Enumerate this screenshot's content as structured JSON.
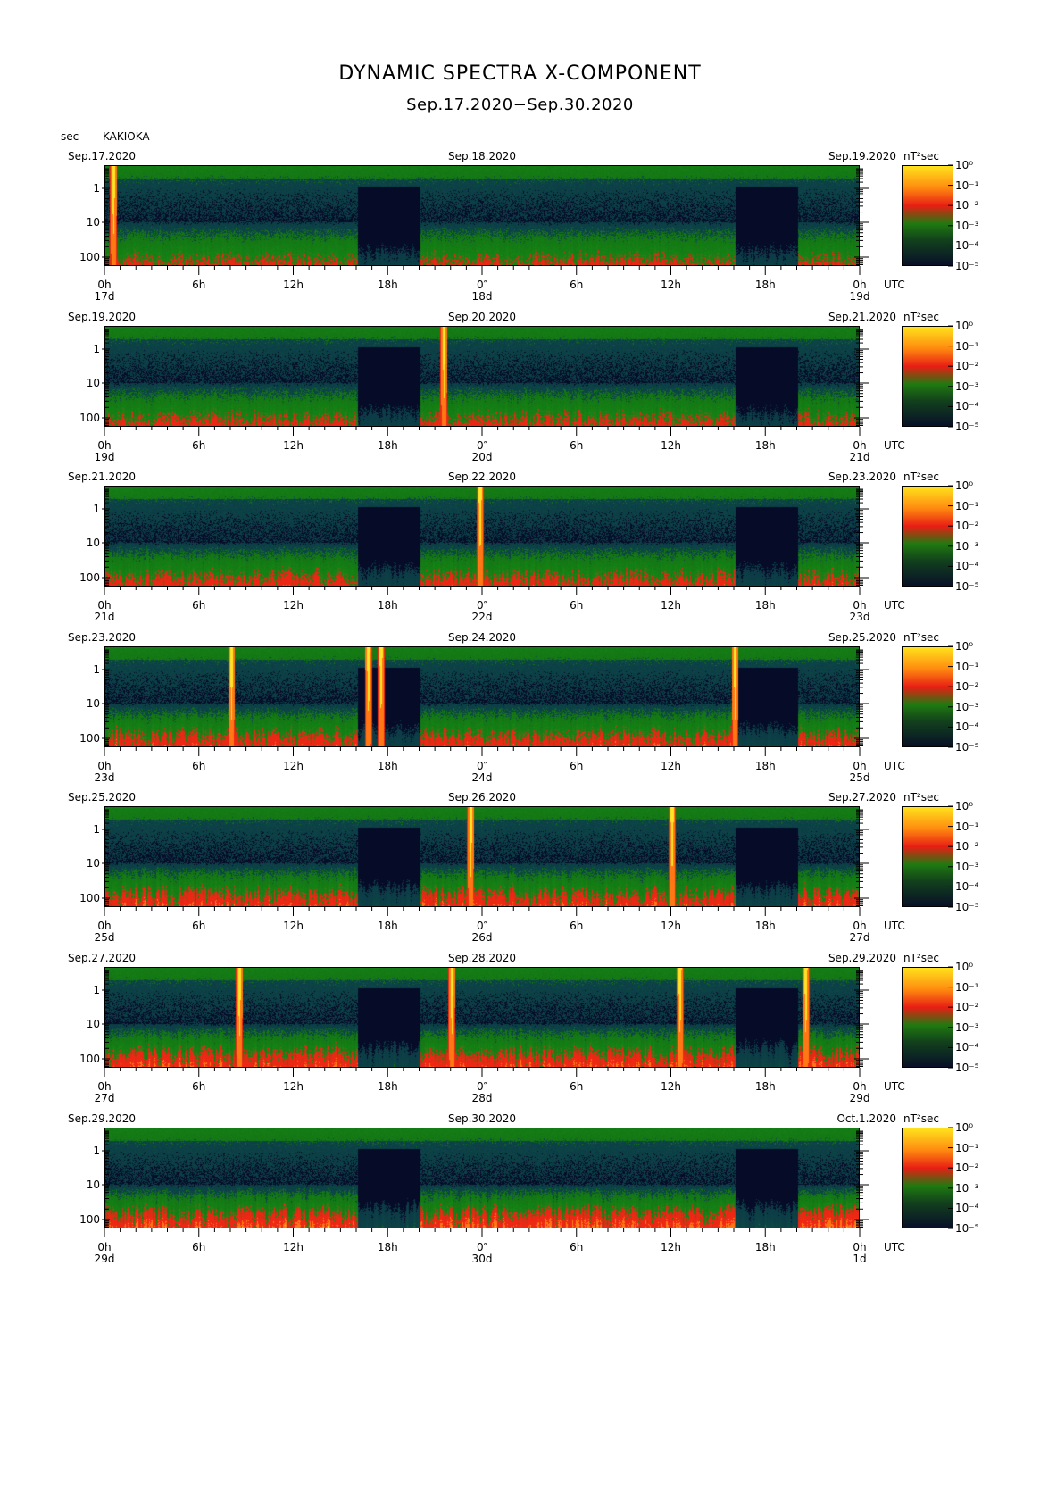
{
  "title": "DYNAMIC SPECTRA X-COMPONENT",
  "subtitle": "Sep.17.2020−Sep.30.2020",
  "y_unit": "sec",
  "station": "KAKIOKA",
  "utc_label": "UTC",
  "colorbar_unit": "nT²sec",
  "chart_data": {
    "type": "heatmap",
    "title": "DYNAMIC SPECTRA X-COMPONENT",
    "subtitle": "Sep.17.2020−Sep.30.2020",
    "ylabel": "sec",
    "y_scale": "log",
    "y_ticks": [
      "1",
      "10",
      "100"
    ],
    "x_ticks": [
      "0h",
      "6h",
      "12h",
      "18h",
      "0″",
      "6h",
      "12h",
      "18h",
      "0h"
    ],
    "colorbar": {
      "unit": "nT²sec",
      "scale": "log",
      "ticks": [
        "10⁰",
        "10⁻¹",
        "10⁻²",
        "10⁻³",
        "10⁻⁴",
        "10⁻⁵"
      ],
      "colors": [
        "#ffe21c",
        "#e81e14",
        "#1f7a10",
        "#081028"
      ]
    },
    "panels": [
      {
        "start_date": "Sep.17.2020",
        "mid_date": "Sep.18.2020",
        "end_date": "Sep.19.2020",
        "day_labels": [
          "17d",
          "18d",
          "19d"
        ],
        "spikes_h": [
          0.5
        ],
        "quiet_intervals_h": [
          [
            16,
            20
          ],
          [
            40,
            44
          ]
        ]
      },
      {
        "start_date": "Sep.19.2020",
        "mid_date": "Sep.20.2020",
        "end_date": "Sep.21.2020",
        "day_labels": [
          "19d",
          "20d",
          "21d"
        ],
        "spikes_h": [
          21.5
        ],
        "quiet_intervals_h": [
          [
            16,
            20
          ],
          [
            40,
            44
          ]
        ]
      },
      {
        "start_date": "Sep.21.2020",
        "mid_date": "Sep.22.2020",
        "end_date": "Sep.23.2020",
        "day_labels": [
          "21d",
          "22d",
          "23d"
        ],
        "spikes_h": [
          23.8
        ],
        "quiet_intervals_h": [
          [
            16,
            20
          ],
          [
            40,
            44
          ]
        ]
      },
      {
        "start_date": "Sep.23.2020",
        "mid_date": "Sep.24.2020",
        "end_date": "Sep.25.2020",
        "day_labels": [
          "23d",
          "24d",
          "25d"
        ],
        "spikes_h": [
          8,
          16.7,
          17.5,
          40
        ],
        "quiet_intervals_h": [
          [
            16,
            20
          ],
          [
            40,
            44
          ]
        ]
      },
      {
        "start_date": "Sep.25.2020",
        "mid_date": "Sep.26.2020",
        "end_date": "Sep.27.2020",
        "day_labels": [
          "25d",
          "26d",
          "27d"
        ],
        "spikes_h": [
          23.2,
          36
        ],
        "quiet_intervals_h": [
          [
            16,
            20
          ],
          [
            40,
            44
          ]
        ]
      },
      {
        "start_date": "Sep.27.2020",
        "mid_date": "Sep.28.2020",
        "end_date": "Sep.29.2020",
        "day_labels": [
          "27d",
          "28d",
          "29d"
        ],
        "spikes_h": [
          8.5,
          22,
          36.5,
          44.5
        ],
        "quiet_intervals_h": [
          [
            16,
            20
          ],
          [
            40,
            44
          ]
        ]
      },
      {
        "start_date": "Sep.29.2020",
        "mid_date": "Sep.30.2020",
        "end_date": "Oct.1.2020",
        "day_labels": [
          "29d",
          "30d",
          "1d"
        ],
        "spikes_h": [],
        "quiet_intervals_h": [
          [
            16,
            20
          ],
          [
            40,
            44
          ]
        ]
      }
    ]
  }
}
